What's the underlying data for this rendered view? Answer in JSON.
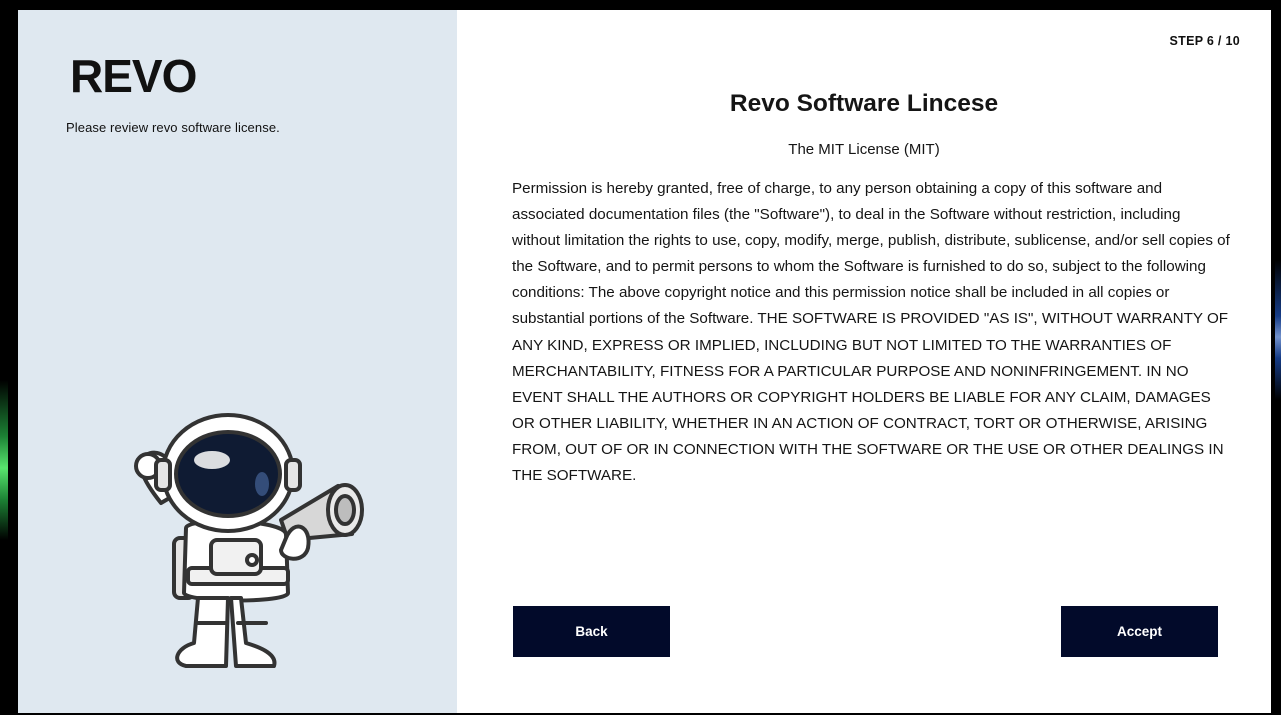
{
  "sidebar": {
    "logo_text": "REVO",
    "subtitle": "Please review revo software license.",
    "illustration": "astronaut-with-megaphone"
  },
  "main": {
    "step": "STEP 6 / 10",
    "title": "Revo Software Lincese",
    "subtitle": "The MIT License (MIT)",
    "license_text": "Permission is hereby granted, free of charge, to any person obtaining a copy of this software and associated documentation files (the \"Software\"), to deal in the Software without restriction, including without limitation the rights to use, copy, modify, merge, publish, distribute, sublicense, and/or sell copies of the Software, and to permit persons to whom the Software is furnished to do so, subject to the following conditions: The above copyright notice and this permission notice shall be included in all copies or substantial portions of the Software. THE SOFTWARE IS PROVIDED \"AS IS\", WITHOUT WARRANTY OF ANY KIND, EXPRESS OR IMPLIED, INCLUDING BUT NOT LIMITED TO THE WARRANTIES OF MERCHANTABILITY, FITNESS FOR A PARTICULAR PURPOSE AND NONINFRINGEMENT. IN NO EVENT SHALL THE AUTHORS OR COPYRIGHT HOLDERS BE LIABLE FOR ANY CLAIM, DAMAGES OR OTHER LIABILITY, WHETHER IN AN ACTION OF CONTRACT, TORT OR OTHERWISE, ARISING FROM, OUT OF OR IN CONNECTION WITH THE SOFTWARE OR THE USE OR OTHER DEALINGS IN THE SOFTWARE."
  },
  "buttons": {
    "back_label": "Back",
    "accept_label": "Accept"
  },
  "colors": {
    "sidebar_bg": "#dfe8f0",
    "button_bg": "#020a2a",
    "text": "#151515"
  }
}
